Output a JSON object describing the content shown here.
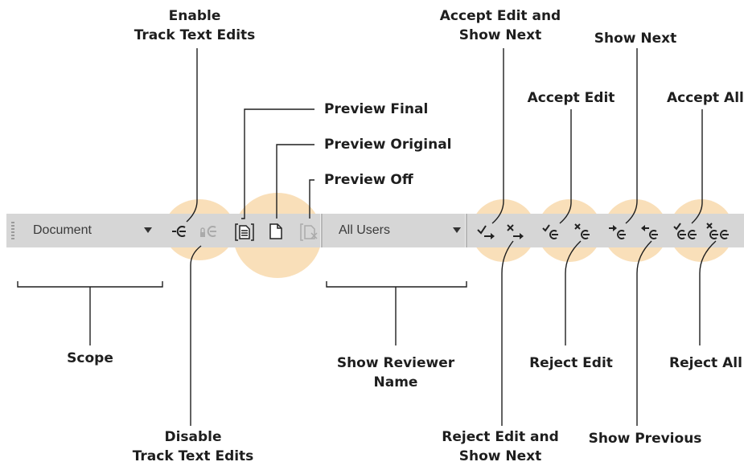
{
  "toolbar": {
    "scope_value": "Document",
    "reviewer_value": "All Users"
  },
  "labels": {
    "enable_track": [
      "Enable",
      "Track Text Edits"
    ],
    "disable_track": [
      "Disable",
      "Track Text Edits"
    ],
    "preview_final": "Preview Final",
    "preview_original": "Preview Original",
    "preview_off": "Preview Off",
    "scope": "Scope",
    "show_reviewer": [
      "Show Reviewer",
      "Name"
    ],
    "accept_show_next": [
      "Accept Edit and",
      "Show Next"
    ],
    "reject_show_next": [
      "Reject Edit and",
      "Show Next"
    ],
    "accept_edit": "Accept Edit",
    "reject_edit": "Reject Edit",
    "show_next": "Show Next",
    "show_previous": "Show Previous",
    "accept_all": "Accept All",
    "reject_all": "Reject All"
  },
  "colors": {
    "highlight": "#f9dfb9",
    "toolbar": "#d6d6d6",
    "line": "#1e1e1e"
  },
  "icons": [
    "enable-track-edits-icon",
    "disable-track-edits-icon",
    "preview-final-icon",
    "preview-original-icon",
    "preview-off-icon",
    "accept-edit-show-next-icon",
    "reject-edit-show-next-icon",
    "accept-edit-icon",
    "reject-edit-icon",
    "show-next-icon",
    "show-previous-icon",
    "accept-all-icon",
    "reject-all-icon"
  ]
}
